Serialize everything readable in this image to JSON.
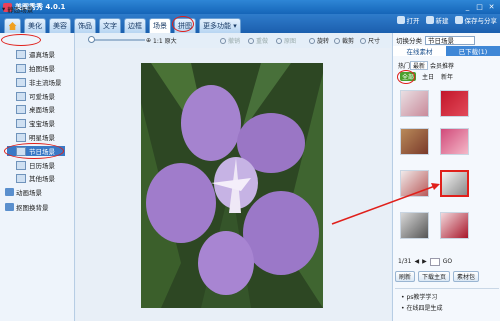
{
  "app": {
    "title": "美图秀秀 4.0.1"
  },
  "window_controls": [
    "_",
    "□",
    "✕"
  ],
  "tabs": [
    {
      "icon": "home-icon"
    },
    {
      "label": "美化"
    },
    {
      "label": "美容"
    },
    {
      "label": "饰品"
    },
    {
      "label": "文字"
    },
    {
      "label": "边框"
    },
    {
      "label": "场景",
      "active": true
    },
    {
      "label": "拼图"
    },
    {
      "label": "更多功能 ▾"
    }
  ],
  "title_actions": {
    "open": "打开",
    "new": "新建",
    "save": "保存与分享"
  },
  "left_panel": {
    "root": "静态场景",
    "items": [
      "逼真场景",
      "拍图场景",
      "非主流场景",
      "可爱场景",
      "桌面场景",
      "宝宝场景",
      "明星场景",
      "节日场景",
      "日历场景",
      "其他场景"
    ],
    "selected_index": 7,
    "bottom": [
      "动画场景",
      "抠图换背景"
    ]
  },
  "toolbar": {
    "zoom_label": "1:1 原大",
    "rotate": "旋转",
    "crop": "裁剪",
    "size": "尺寸",
    "undo": "撤销",
    "redo": "重做",
    "original": "原图"
  },
  "right_panel": {
    "category_label": "切换分类",
    "category_value": "节日场景",
    "tabs": [
      "在线素材",
      "已下载(1)"
    ],
    "subtabs": [
      "热门",
      "最新",
      "会员推荐"
    ],
    "cats": [
      "全部",
      "主日",
      "新年"
    ],
    "pager": "1/31",
    "go": "GO",
    "buttons": [
      "刷新",
      "下载主页",
      "素材包"
    ],
    "help": [
      "ps教学学习",
      "在线四是生成"
    ]
  },
  "colors": {
    "accent": "#2f7ccb",
    "highlight": "#e0201b",
    "category_green": "#4aa02c"
  }
}
